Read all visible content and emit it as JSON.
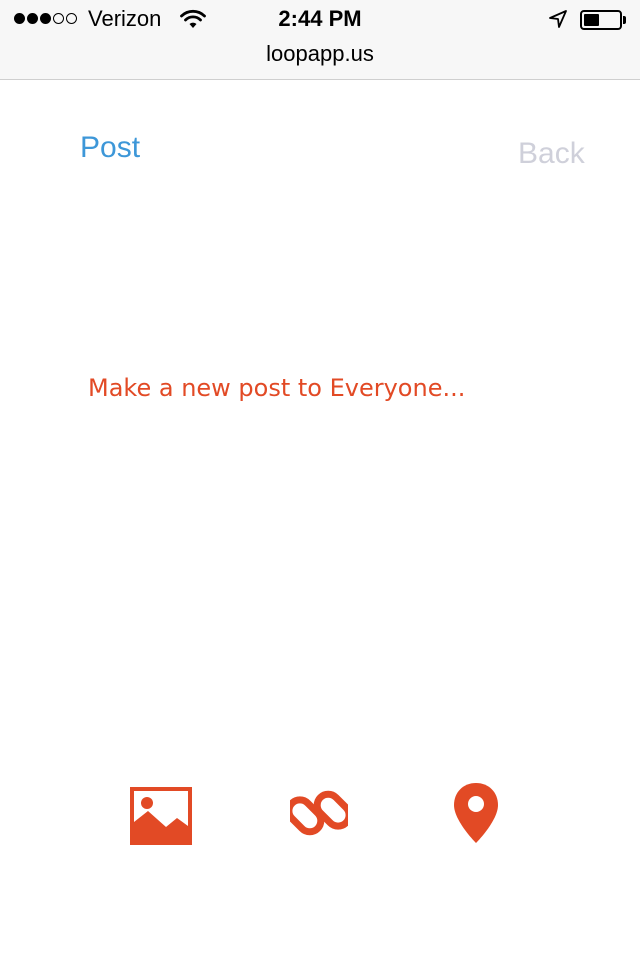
{
  "status_bar": {
    "carrier": "Verizon",
    "time": "2:44 PM",
    "signal_bars_filled": 3,
    "signal_bars_total": 5,
    "battery_level": 0.45,
    "icons": [
      "wifi-icon",
      "location-arrow-icon",
      "battery-icon"
    ]
  },
  "browser": {
    "url": "loopapp.us"
  },
  "header": {
    "post_label": "Post",
    "back_label": "Back"
  },
  "composer": {
    "placeholder": "Make a new post to Everyone..."
  },
  "toolbar": {
    "icons": [
      "image-icon",
      "link-icon",
      "location-pin-icon"
    ]
  },
  "colors": {
    "accent_blue": "#3d97d8",
    "accent_orange": "#e24a25",
    "disabled_gray": "#cfd0da"
  }
}
